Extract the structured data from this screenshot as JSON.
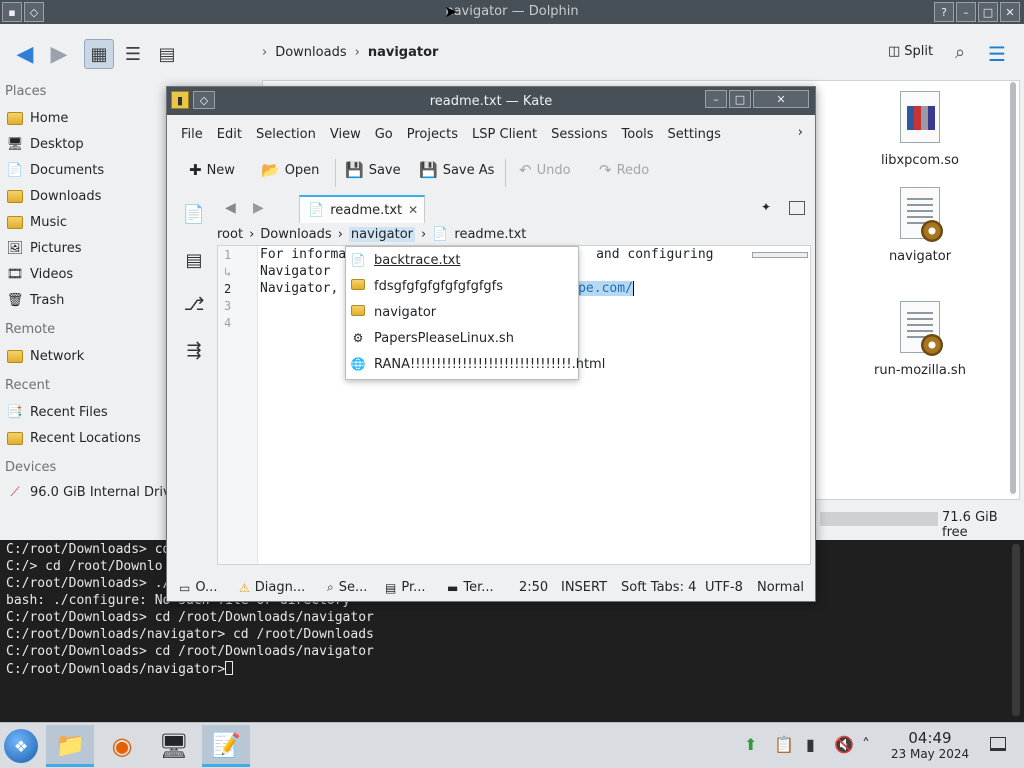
{
  "dolphin": {
    "title": "navigator — Dolphin",
    "breadcrumb": [
      "Downloads",
      "navigator"
    ],
    "split_label": "Split",
    "places": {
      "places_head": "Places",
      "items": [
        "Home",
        "Desktop",
        "Documents",
        "Downloads",
        "Music",
        "Pictures",
        "Videos",
        "Trash"
      ],
      "remote_head": "Remote",
      "remote_items": [
        "Network"
      ],
      "recent_head": "Recent",
      "recent_items": [
        "Recent Files",
        "Recent Locations"
      ],
      "devices_head": "Devices",
      "device_items": [
        "96.0 GiB Internal Drive"
      ]
    },
    "files": [
      "libxpcom.so",
      "navigator",
      "run-mozilla.sh"
    ],
    "free_space": "71.6 GiB free"
  },
  "terminal": {
    "lines": [
      "C:/root/Downloads> cd",
      "C:/> cd /root/Downlo",
      "C:/root/Downloads> ./",
      "bash: ./configure: No such file or directory",
      "C:/root/Downloads> cd /root/Downloads/navigator",
      "C:/root/Downloads/navigator> cd /root/Downloads",
      "C:/root/Downloads> cd /root/Downloads/navigator",
      "C:/root/Downloads/navigator>"
    ]
  },
  "kate": {
    "title": "readme.txt — Kate",
    "menu": [
      "File",
      "Edit",
      "Selection",
      "View",
      "Go",
      "Projects",
      "LSP Client",
      "Sessions",
      "Tools",
      "Settings"
    ],
    "toolbar": {
      "new": "New",
      "open": "Open",
      "save": "Save",
      "save_as": "Save As",
      "undo": "Undo",
      "redo": "Redo"
    },
    "tab_label": "readme.txt",
    "breadcrumb": [
      "root",
      "Downloads",
      "navigator",
      "readme.txt"
    ],
    "line_numbers": [
      "1",
      "2",
      "3",
      "4"
    ],
    "code": {
      "line1a": "For informa",
      "line1b": "and configuring",
      "line1c": "Navigator",
      "line2a": "Navigator,",
      "line2b": "ape.com/"
    },
    "completion": [
      "backtrace.txt",
      "fdsgfgfgfgfgfgfgfgfs",
      "navigator",
      "PapersPleaseLinux.sh",
      "RANA!!!!!!!!!!!!!!!!!!!!!!!!!!!!!!!.html"
    ],
    "status": {
      "output": "O...",
      "diagnostics": "Diagn...",
      "search": "Se...",
      "projects": "Pr...",
      "terminal": "Ter...",
      "position": "2:50",
      "mode": "INSERT",
      "indent": "Soft Tabs: 4",
      "encoding": "UTF-8",
      "syntax": "Normal"
    }
  },
  "taskbar": {
    "time": "04:49",
    "date": "23 May 2024"
  },
  "colors": {
    "accent": "#3daee9",
    "titlebar": "#475057",
    "terminal_bg": "#1f1f1f"
  }
}
